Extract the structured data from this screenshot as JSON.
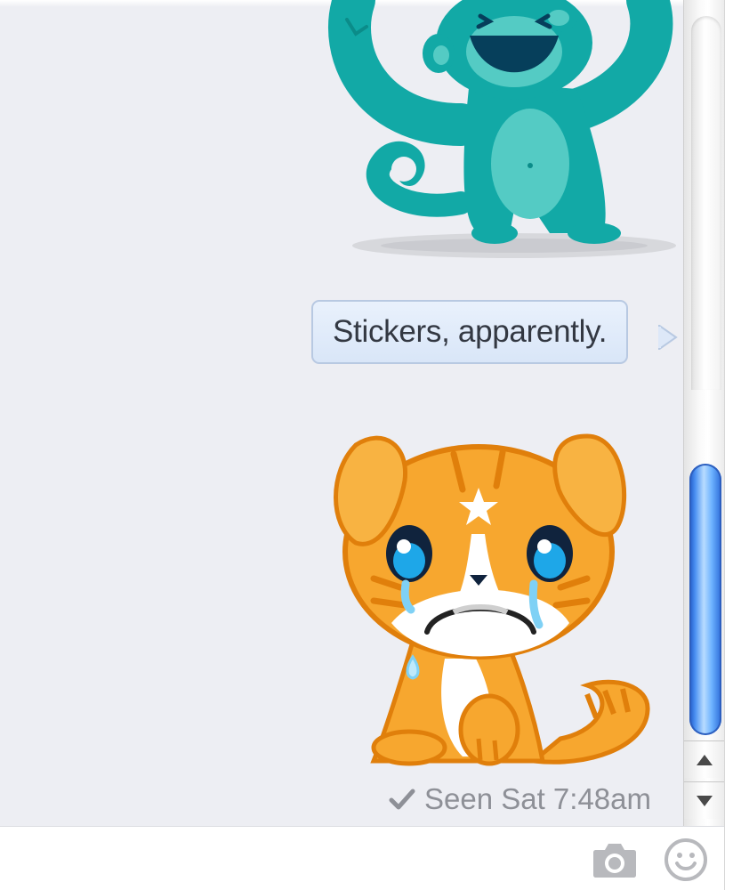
{
  "conversation": {
    "messages": [
      {
        "kind": "sticker",
        "sticker_name": "cheering-monkey"
      },
      {
        "kind": "text",
        "text": "Stickers, apparently."
      },
      {
        "kind": "sticker",
        "sticker_name": "crying-kitten"
      }
    ],
    "seen_status": "Seen Sat 7:48am"
  },
  "composer": {
    "icons": [
      "camera-icon",
      "smiley-icon"
    ]
  },
  "scrollbar": {
    "arrows": [
      "scroll-up-arrow-icon",
      "scroll-down-arrow-icon"
    ]
  },
  "colors": {
    "chat_background": "#edeef3",
    "bubble_fill": "#dde8f8",
    "bubble_border": "#b8c9e2",
    "monkey_teal": "#12a9a6",
    "kitten_orange": "#f7a72f",
    "scroll_thumb": "#4a90f2",
    "seen_text": "#8e9097"
  }
}
